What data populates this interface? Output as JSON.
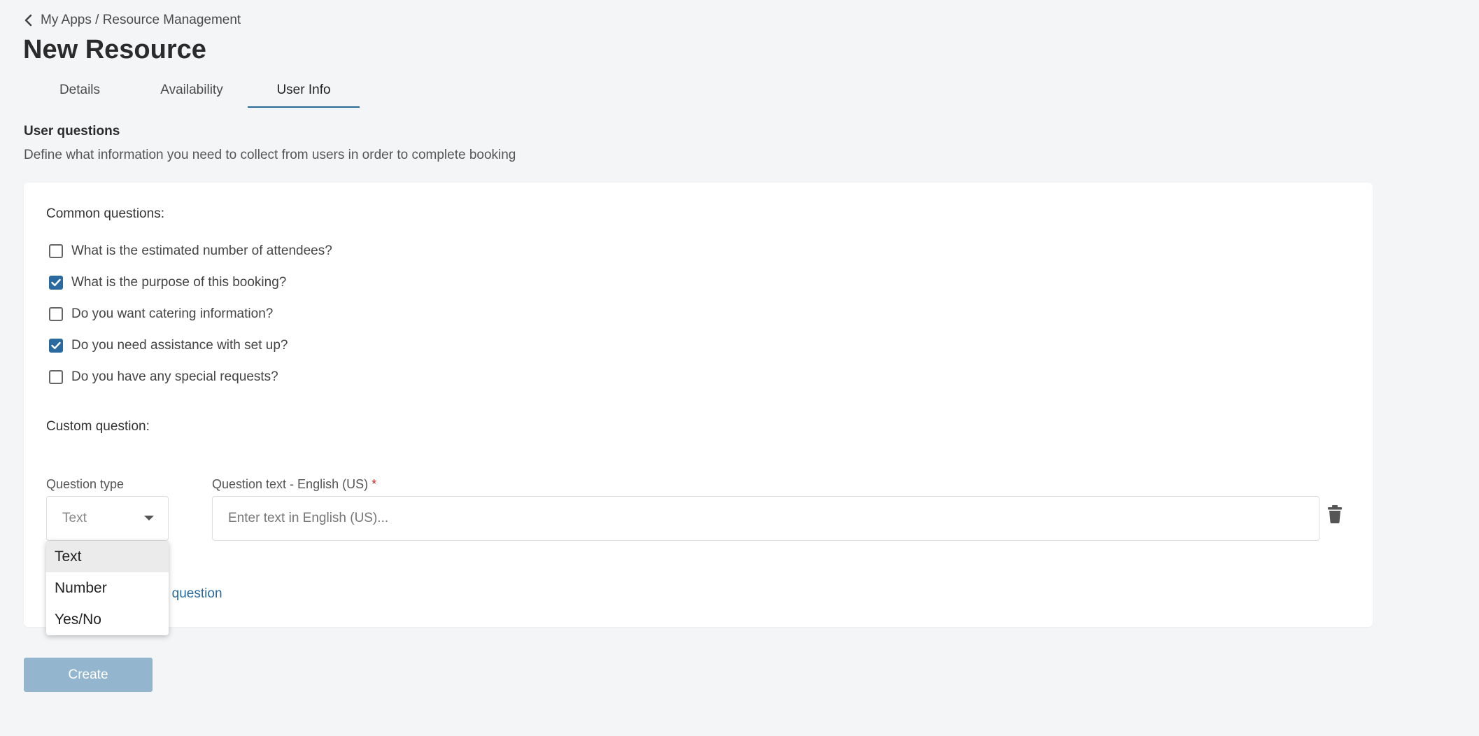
{
  "breadcrumb": {
    "text": "My Apps / Resource Management"
  },
  "page": {
    "title": "New Resource"
  },
  "tabs": [
    {
      "label": "Details",
      "active": false
    },
    {
      "label": "Availability",
      "active": false
    },
    {
      "label": "User Info",
      "active": true
    }
  ],
  "section": {
    "title": "User questions",
    "description": "Define what information you need to collect from users in order to complete booking"
  },
  "common": {
    "label": "Common questions:",
    "questions": [
      {
        "label": "What is the estimated number of attendees?",
        "checked": false
      },
      {
        "label": "What is the purpose of this booking?",
        "checked": true
      },
      {
        "label": "Do you want catering information?",
        "checked": false
      },
      {
        "label": "Do you need assistance with set up?",
        "checked": true
      },
      {
        "label": "Do you have any special requests?",
        "checked": false
      }
    ]
  },
  "custom": {
    "label": "Custom question:",
    "type_label": "Question type",
    "type_value": "Text",
    "text_label": "Question text - English (US)",
    "required_mark": "*",
    "text_placeholder": "Enter text in English (US)...",
    "add_link_partial": "om question",
    "type_options": [
      "Text",
      "Number",
      "Yes/No"
    ],
    "selected_option": "Text"
  },
  "actions": {
    "create_label": "Create"
  },
  "colors": {
    "accent": "#2a6a9e",
    "button_disabled": "#93b5ce",
    "required": "#c62828",
    "background": "#f4f5f7"
  }
}
